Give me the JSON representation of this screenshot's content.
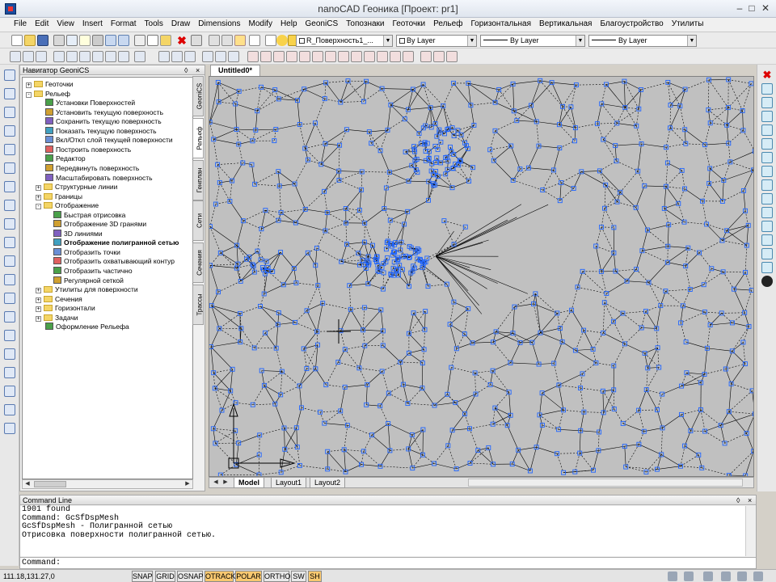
{
  "window": {
    "title": "nanoCAD Геоника [Проект: pr1]"
  },
  "menu": [
    "File",
    "Edit",
    "View",
    "Insert",
    "Format",
    "Tools",
    "Draw",
    "Dimensions",
    "Modify",
    "Help",
    "GeoniCS",
    "Топознаки",
    "Геоточки",
    "Рельеф",
    "Горизонтальная",
    "Вертикальная",
    "Благоустройство",
    "Утилиты"
  ],
  "toolbar": {
    "layer_combo": "R_Поверхность1_...",
    "color_combo": "By Layer",
    "linetype_combo": "By Layer",
    "lineweight_combo": "By Layer"
  },
  "navigator": {
    "title": "Навигатор GeoniCS",
    "tabs": [
      "GeoniCS",
      "Рельеф",
      "Генплан",
      "Сети",
      "Сечения",
      "Трассы"
    ],
    "tree": [
      {
        "label": "Геоточки",
        "level": 0,
        "type": "folder",
        "expand": "+"
      },
      {
        "label": "Рельеф",
        "level": 0,
        "type": "folder",
        "expand": "-"
      },
      {
        "label": "Установки Поверхностей",
        "level": 1,
        "type": "item"
      },
      {
        "label": "Установить текущую поверхность",
        "level": 1,
        "type": "item"
      },
      {
        "label": "Сохранить текущую поверхность",
        "level": 1,
        "type": "item"
      },
      {
        "label": "Показать текущую поверхность",
        "level": 1,
        "type": "item"
      },
      {
        "label": "Вкл/Откл слой текущей поверхности",
        "level": 1,
        "type": "item"
      },
      {
        "label": "Построить поверхность",
        "level": 1,
        "type": "item"
      },
      {
        "label": "Редактор",
        "level": 1,
        "type": "item"
      },
      {
        "label": "Передвинуть поверхность",
        "level": 1,
        "type": "item"
      },
      {
        "label": "Масштабировать поверхность",
        "level": 1,
        "type": "item"
      },
      {
        "label": "Структурные линии",
        "level": 1,
        "type": "folder",
        "expand": "+"
      },
      {
        "label": "Границы",
        "level": 1,
        "type": "folder",
        "expand": "+"
      },
      {
        "label": "Отображение",
        "level": 1,
        "type": "folder",
        "expand": "-"
      },
      {
        "label": "Быстрая отрисовка",
        "level": 2,
        "type": "item"
      },
      {
        "label": "Отображение 3D гранями",
        "level": 2,
        "type": "item"
      },
      {
        "label": "3D линиями",
        "level": 2,
        "type": "item"
      },
      {
        "label": "Отображение полигранной сетью",
        "level": 2,
        "type": "item",
        "bold": true
      },
      {
        "label": "Отобразить точки",
        "level": 2,
        "type": "item"
      },
      {
        "label": "Отобразить охватывающий контур",
        "level": 2,
        "type": "item"
      },
      {
        "label": "Отобразить частично",
        "level": 2,
        "type": "item"
      },
      {
        "label": "Регулярной сеткой",
        "level": 2,
        "type": "item"
      },
      {
        "label": "Утилиты для поверхности",
        "level": 1,
        "type": "folder",
        "expand": "+"
      },
      {
        "label": "Сечения",
        "level": 1,
        "type": "folder",
        "expand": "+"
      },
      {
        "label": "Горизонтали",
        "level": 1,
        "type": "folder",
        "expand": "+"
      },
      {
        "label": "Задачи",
        "level": 1,
        "type": "folder",
        "expand": "+"
      },
      {
        "label": "Оформление Рельефа",
        "level": 1,
        "type": "item"
      }
    ]
  },
  "document": {
    "tab": "Untitled0*",
    "layout_tabs": [
      "Model",
      "Layout1",
      "Layout2"
    ],
    "active_layout": "Model"
  },
  "command_line": {
    "title": "Command Line",
    "history": [
      "1901 found",
      "Command: GcSfDspMesh",
      "GcSfDspMesh - Полигранной сетью",
      "Отрисовка поверхности полигранной сетью."
    ],
    "prompt": "Command:"
  },
  "status": {
    "coords": "111.18,131.27,0",
    "buttons": [
      {
        "label": "SNAP",
        "on": false
      },
      {
        "label": "GRID",
        "on": false
      },
      {
        "label": "OSNAP",
        "on": false
      },
      {
        "label": "OTRACK",
        "on": true
      },
      {
        "label": "POLAR",
        "on": true
      },
      {
        "label": "ORTHO",
        "on": false
      },
      {
        "label": "SW",
        "on": false
      },
      {
        "label": "SH",
        "on": true
      }
    ]
  },
  "colors": {
    "mesh_line": "#000000",
    "mesh_point": "#1e64ff",
    "viewport_bg": "#c0c0c0",
    "toggle_on": "#f8c870"
  }
}
